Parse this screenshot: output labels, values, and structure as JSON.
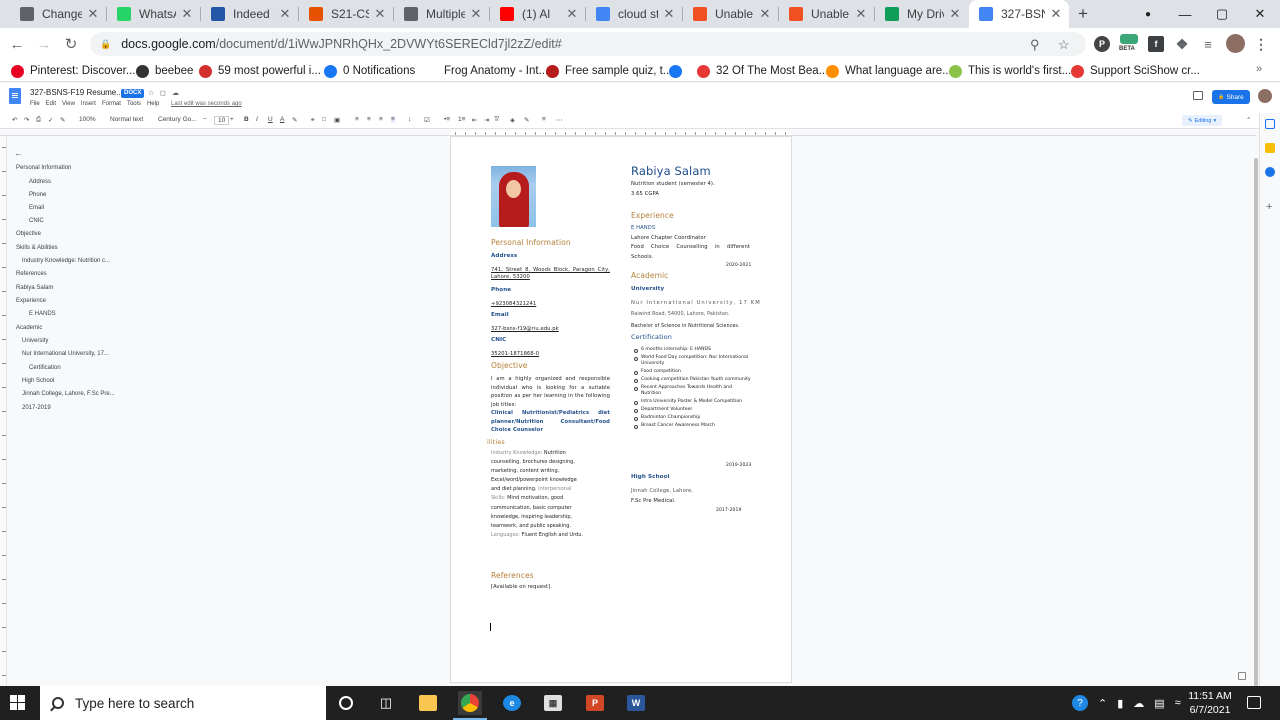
{
  "browser": {
    "tabs": [
      {
        "title": "Change In",
        "icon": "layers-icon",
        "color": "#5f6368"
      },
      {
        "title": "WhatsApp",
        "icon": "whatsapp-icon",
        "color": "#25d366"
      },
      {
        "title": "Indeed Re",
        "icon": "indeed-icon",
        "color": "#2557a7"
      },
      {
        "title": "S21-CSCS",
        "icon": "in-icon",
        "color": "#e65100"
      },
      {
        "title": "Multiple-",
        "icon": "globe-icon",
        "color": "#5f6368"
      },
      {
        "title": "(1) Al",
        "icon": "youtube-icon",
        "color": "#ff0000"
      },
      {
        "title": "cloud sto",
        "icon": "google-icon",
        "color": "#4285f4"
      },
      {
        "title": "Unable to",
        "icon": "microsoft-icon",
        "color": "#f25022"
      },
      {
        "title": "Unable to",
        "icon": "microsoft-icon",
        "color": "#f25022"
      },
      {
        "title": "My Drive",
        "icon": "drive-icon",
        "color": "#0f9d58"
      },
      {
        "title": "327-BSNS",
        "icon": "docs-icon",
        "color": "#4285f4"
      }
    ],
    "url_domain": "docs.google.com",
    "url_path": "/document/d/1iWwJPNRhQHx_2DVWYt6SERECld7jl2zZ/edit#",
    "beta_label": "BETA",
    "bookmarks": [
      {
        "label": "Pinterest: Discover...",
        "color": "#e60023",
        "icon": "pinterest-icon"
      },
      {
        "label": "beebee",
        "color": "#333333",
        "icon": "iz-icon"
      },
      {
        "label": "59 most powerful i...",
        "color": "#d32f2f",
        "icon": "t-icon"
      },
      {
        "label": "0 Notifications",
        "color": "#1877f2",
        "icon": "facebook-icon"
      },
      {
        "label": "Frog Anatomy - Int...",
        "color": "#ffffff",
        "icon": "frog-icon"
      },
      {
        "label": "Free sample quiz, t...",
        "color": "#b71c1c",
        "icon": "quiz-icon"
      },
      {
        "label": "",
        "color": "#1877f2",
        "icon": "facebook-icon"
      },
      {
        "label": "32 Of The Most Bea...",
        "color": "#e53935",
        "icon": "trend-icon"
      },
      {
        "label": "What language are...",
        "color": "#ff8f00",
        "icon": "language-icon"
      },
      {
        "label": "This is world's first...",
        "color": "#8bc34a",
        "icon": "android-icon"
      },
      {
        "label": "Support SciShow cr...",
        "color": "#e53935",
        "icon": "patreon-icon"
      }
    ]
  },
  "docs": {
    "title": "327-BSNS-F19 Resume...",
    "badge": "DOCX",
    "menus": [
      "File",
      "Edit",
      "View",
      "Insert",
      "Format",
      "Tools",
      "Help"
    ],
    "last_edit": "Last edit was seconds ago",
    "share_label": "Share",
    "toolbar": {
      "zoom": "100%",
      "style": "Normal text",
      "font": "Century Go...",
      "size": "10",
      "mode": "Editing"
    },
    "outline": [
      {
        "text": "Personal Information",
        "level": 1
      },
      {
        "text": "Address",
        "level": 3
      },
      {
        "text": "Phone",
        "level": 3
      },
      {
        "text": "Email",
        "level": 3
      },
      {
        "text": "CNIC",
        "level": 3
      },
      {
        "text": "Objective",
        "level": 1
      },
      {
        "text": "Skills & Abilities",
        "level": 1
      },
      {
        "text": "Industry Knowledge: Nutrition c...",
        "level": 2
      },
      {
        "text": "References",
        "level": 1
      },
      {
        "text": "Rabiya Salam",
        "level": 1
      },
      {
        "text": "Experience",
        "level": 1
      },
      {
        "text": "E HANDS",
        "level": 3
      },
      {
        "text": "Academic",
        "level": 1
      },
      {
        "text": "University",
        "level": 2
      },
      {
        "text": "Nur International University, 17...",
        "level": 2
      },
      {
        "text": "Certification",
        "level": 3
      },
      {
        "text": "High School",
        "level": 2
      },
      {
        "text": "Jinnah College, Lahore, F.Sc Pre...",
        "level": 2
      },
      {
        "text": "2017-2019",
        "level": 2
      }
    ]
  },
  "resume": {
    "name": "Rabiya Salam",
    "tagline1": "Nutrition student (semester 4).",
    "tagline2": "3.65 CGPA",
    "personal_heading": "Personal Information",
    "address_label": "Address",
    "address_value": "741, Street 8, Woods Block, Paragon City, Lahore, 53200",
    "phone_label": "Phone",
    "phone_value": "+923084321241",
    "email_label": "Email",
    "email_value": "327-bsns-f19@riu.edu.pk",
    "cnic_label": "CNIC",
    "cnic_value": "35201-1871868-0",
    "objective_heading": "Objective",
    "objective_text": "I am a highly organized and responsible individual who is looking for a suitable position as per her learning in the following job titles:",
    "objective_roles": "Clinical Nutritionist/Pediatrics diet planner/Nutrition Consultant/Food Choice Counselor",
    "skills_heading": "ilities",
    "skills": [
      {
        "label": "Industry Knowledge:",
        "text": " Nutrition counselling, brochures designing, marketing, content writing, Excel/word/powerpoint knowledge and diet planning."
      },
      {
        "label": "Interpersonal Skills:",
        "text": " Mind motivation, good communication, basic computer knowledge, inspiring leadership, teamwork, and public speaking."
      },
      {
        "label": "Languages:",
        "text": " Fluent English and Urdu."
      }
    ],
    "references_heading": "References",
    "references_text": "[Available on request].",
    "experience_heading": "Experience",
    "experience_org": "E HANDS",
    "experience_role": "Lahore Chapter Coordinator",
    "experience_desc": "Food Choice Counselling in different Schools.",
    "experience_years": "2020-2021",
    "academic_heading": "Academic",
    "university_label": "University",
    "university_name": "Nur International University, 17 KM",
    "university_addr": "Raiwind Road, 54000, Lahore, Pakistan.",
    "university_degree": "Bachelor of Science in Nutritional Sciences.",
    "certification_heading": "Certification",
    "certifications": [
      "6 months internship: E HANDS",
      "World Food Day competition: Nur International University",
      "Food competition",
      "Cooking competition Pakistan Youth community",
      "Recent Approaches Towards Health and Nutrition",
      "Intra University Poster & Model Competition",
      "Department Volunteer",
      "Badminton Championship",
      "Breast Cancer Awareness March"
    ],
    "certification_years": "2019-2023",
    "highschool_label": "High School",
    "highschool_name": "Jinnah College, Lahore,",
    "highschool_program": "F.Sc Pre Medical.",
    "highschool_years": "2017-2019"
  },
  "taskbar": {
    "search_placeholder": "Type here to search",
    "time": "11:51 AM",
    "date": "6/7/2021"
  }
}
